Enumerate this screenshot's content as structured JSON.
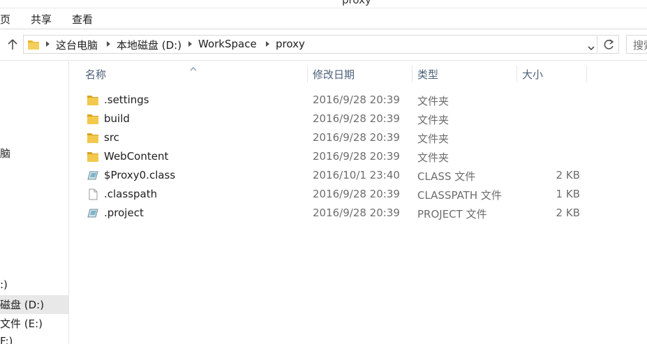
{
  "window": {
    "title_tail": "proxy"
  },
  "ribbon": {
    "tabs": [
      "页",
      "共享",
      "查看"
    ]
  },
  "address": {
    "crumbs": [
      "这台电脑",
      "本地磁盘 (D:)",
      "WorkSpace",
      "proxy"
    ],
    "search_placeholder": "搜索"
  },
  "nav": {
    "items": [
      {
        "label": "脑",
        "selected": false
      },
      {
        "label": ":)",
        "selected": false
      },
      {
        "label": "磁盘 (D:)",
        "selected": true
      },
      {
        "label": "文件 (E:)",
        "selected": false
      },
      {
        "label": "F:)",
        "selected": false
      }
    ]
  },
  "columns": {
    "name": "名称",
    "date": "修改日期",
    "type": "类型",
    "size": "大小"
  },
  "files": [
    {
      "name": ".settings",
      "date": "2016/9/28 20:39",
      "type": "文件夹",
      "size": "",
      "icon": "folder-icon"
    },
    {
      "name": "build",
      "date": "2016/9/28 20:39",
      "type": "文件夹",
      "size": "",
      "icon": "folder-icon"
    },
    {
      "name": "src",
      "date": "2016/9/28 20:39",
      "type": "文件夹",
      "size": "",
      "icon": "folder-icon"
    },
    {
      "name": "WebContent",
      "date": "2016/9/28 20:39",
      "type": "文件夹",
      "size": "",
      "icon": "folder-icon"
    },
    {
      "name": "$Proxy0.class",
      "date": "2016/10/1 23:40",
      "type": "CLASS 文件",
      "size": "2 KB",
      "icon": "class-file-icon"
    },
    {
      "name": ".classpath",
      "date": "2016/9/28 20:39",
      "type": "CLASSPATH 文件",
      "size": "1 KB",
      "icon": "blank-file-icon"
    },
    {
      "name": ".project",
      "date": "2016/9/28 20:39",
      "type": "PROJECT 文件",
      "size": "2 KB",
      "icon": "class-file-icon"
    }
  ],
  "colors": {
    "folder": "#e8b62e",
    "header_text": "#4c607a",
    "muted_text": "#6d6d6d",
    "selected_bg": "#e8e8e8"
  }
}
